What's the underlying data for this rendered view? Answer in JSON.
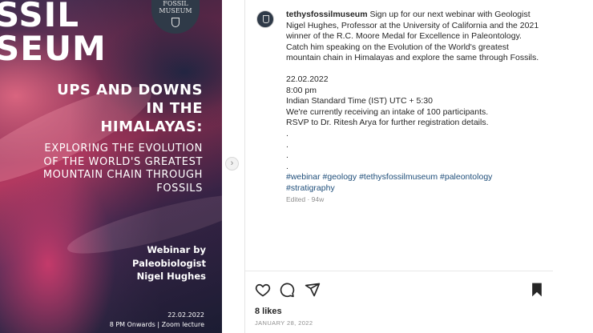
{
  "poster": {
    "title_line1": "SSIL",
    "title_line2": "SEUM",
    "logo_line1": "FOSSIL",
    "logo_line2": "MUSEUM",
    "headline": "UPS AND DOWNS IN THE HIMALAYAS:",
    "subheadline": "EXPLORING THE EVOLUTION OF THE WORLD'S GREATEST MOUNTAIN CHAIN THROUGH FOSSILS",
    "webinar_line1": "Webinar by",
    "webinar_line2": "Paleobiologist",
    "webinar_line3": "Nigel Hughes",
    "date": "22.02.2022",
    "time_line": "8 PM Onwards | Zoom lecture",
    "carousel_next_icon": "chevron-right-icon"
  },
  "post": {
    "username": "tethysfossilmuseum",
    "caption": "Sign up for our next webinar with Geologist Nigel Hughes, Professor at the University of California and the 2021 winner of the R.C. Moore Medal for Excellence in Paleontology. Catch him speaking on the Evolution of the World's greatest mountain chain in Himalayas and explore the same through Fossils.",
    "date": "22.02.2022",
    "time": "8:00 pm",
    "timezone": "Indian Standard Time (IST) UTC + 5:30",
    "intake": "We're currently receiving an intake of 100 participants.",
    "rsvp": "RSVP to Dr. Ritesh Arya for further registration details.",
    "dots": [
      ".",
      ".",
      ".",
      "."
    ],
    "hashtags_line1": "#webinar #geology #tethysfossilmuseum #paleontology",
    "hashtags_line2": "#stratigraphy",
    "edited": "Edited · 94w",
    "likes": "8 likes",
    "posted_date": "JANUARY 28, 2022"
  },
  "actions": {
    "icons": [
      "heart-icon",
      "comment-icon",
      "share-icon",
      "bookmark-icon"
    ]
  },
  "colors": {
    "hashtag": "#1f4e7a",
    "muted": "#8e8e8e",
    "text": "#262626"
  }
}
